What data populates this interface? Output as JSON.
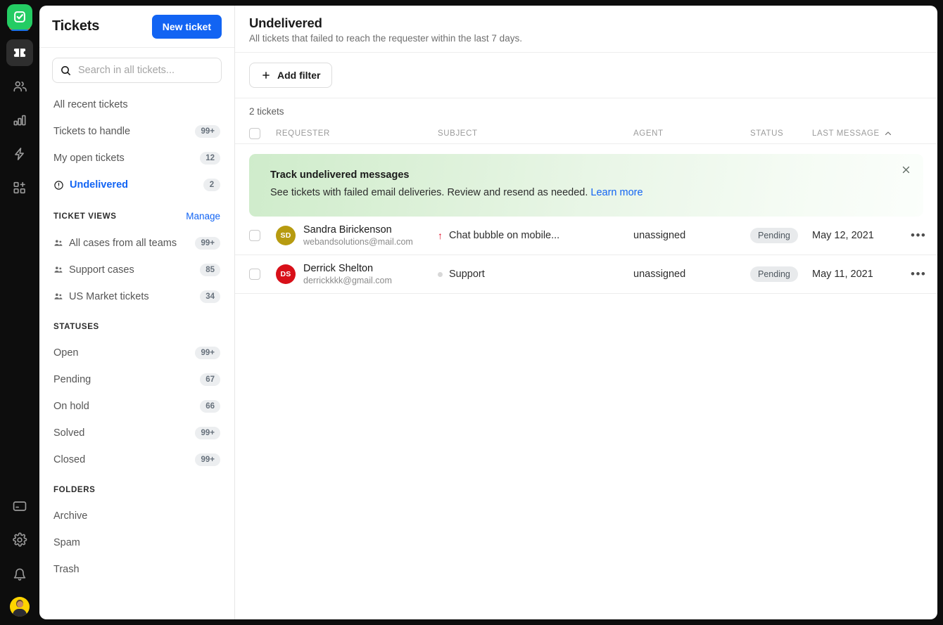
{
  "rail": {
    "logo": {
      "name": "app-logo",
      "color": "#24cc63"
    },
    "items": [
      {
        "icon": "tickets-icon",
        "name": "rail-item-tickets",
        "active": true
      },
      {
        "icon": "contacts-icon",
        "name": "rail-item-contacts",
        "active": false
      },
      {
        "icon": "reports-icon",
        "name": "rail-item-reports",
        "active": false
      },
      {
        "icon": "automations-icon",
        "name": "rail-item-automations",
        "active": false
      },
      {
        "icon": "apps-icon",
        "name": "rail-item-apps",
        "active": false
      }
    ],
    "bottom": [
      {
        "icon": "billing-icon",
        "name": "rail-item-billing"
      },
      {
        "icon": "gear-icon",
        "name": "rail-item-settings"
      },
      {
        "icon": "bell-icon",
        "name": "rail-item-notifications"
      }
    ],
    "avatar": "user-avatar"
  },
  "sidebar": {
    "title": "Tickets",
    "new_ticket_label": "New ticket",
    "search_placeholder": "Search in all tickets...",
    "search_value": "",
    "quick_views": [
      {
        "label": "All recent tickets",
        "count": "",
        "icon": "",
        "active": false
      },
      {
        "label": "Tickets to handle",
        "count": "99+",
        "icon": "",
        "active": false
      },
      {
        "label": "My open tickets",
        "count": "12",
        "icon": "",
        "active": false
      },
      {
        "label": "Undelivered",
        "count": "2",
        "icon": "alert-circle-icon",
        "active": true
      }
    ],
    "ticket_views": {
      "title": "TICKET VIEWS",
      "manage_label": "Manage",
      "items": [
        {
          "label": "All cases from all teams",
          "count": "99+",
          "icon": "team-icon"
        },
        {
          "label": "Support cases",
          "count": "85",
          "icon": "team-icon"
        },
        {
          "label": "US Market tickets",
          "count": "34",
          "icon": "team-icon"
        }
      ]
    },
    "statuses": {
      "title": "STATUSES",
      "items": [
        {
          "label": "Open",
          "count": "99+"
        },
        {
          "label": "Pending",
          "count": "67"
        },
        {
          "label": "On hold",
          "count": "66"
        },
        {
          "label": "Solved",
          "count": "99+"
        },
        {
          "label": "Closed",
          "count": "99+"
        }
      ]
    },
    "folders": {
      "title": "FOLDERS",
      "items": [
        {
          "label": "Archive"
        },
        {
          "label": "Spam"
        },
        {
          "label": "Trash"
        }
      ]
    }
  },
  "main": {
    "title": "Undelivered",
    "subtitle": "All tickets that failed to reach the requester within the last 7 days.",
    "add_filter_label": "Add filter",
    "count_label": "2 tickets",
    "columns": {
      "requester": "REQUESTER",
      "subject": "SUBJECT",
      "agent": "AGENT",
      "status": "STATUS",
      "last_message": "LAST MESSAGE",
      "sort_direction": "asc"
    },
    "banner": {
      "title": "Track undelivered messages",
      "text": "See tickets with failed email deliveries. Review and resend as needed.",
      "link_label": "Learn more",
      "close_icon": "close-icon",
      "accent": "#cfeccb"
    },
    "rows": [
      {
        "initials": "SD",
        "avatar_color": "#b79b10",
        "name": "Sandra Birickenson",
        "email": "webandsolutions@mail.com",
        "priority": "high",
        "subject": "Chat bubble on mobile...",
        "agent": "unassigned",
        "status": "Pending",
        "last_message": "May 12, 2021"
      },
      {
        "initials": "DS",
        "avatar_color": "#d81019",
        "name": "Derrick Shelton",
        "email": "derrickkkk@gmail.com",
        "priority": "normal",
        "subject": "Support",
        "agent": "unassigned",
        "status": "Pending",
        "last_message": "May 11, 2021"
      }
    ]
  }
}
